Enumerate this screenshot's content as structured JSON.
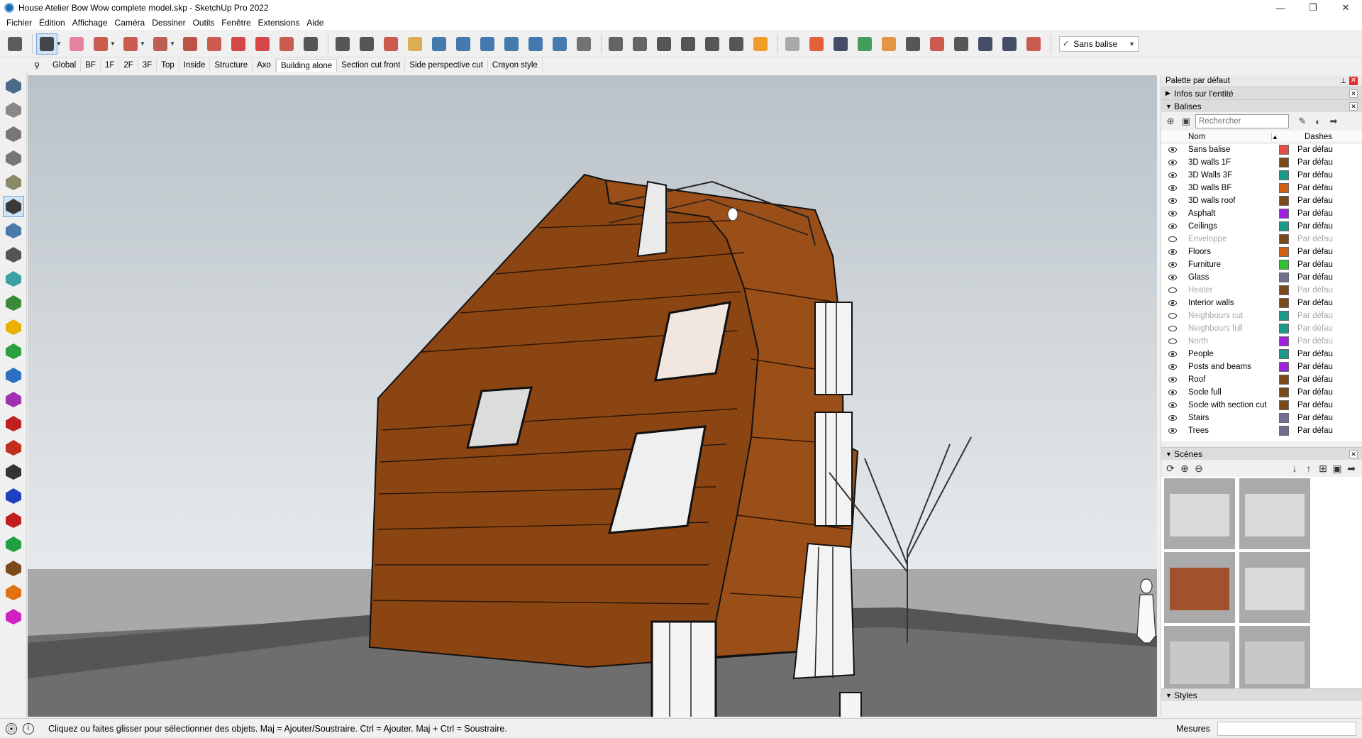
{
  "window": {
    "title": "House Atelier Bow Wow complete model.skp - SketchUp Pro 2022",
    "minimize": "—",
    "restore": "❐",
    "close": "✕"
  },
  "menu": [
    "Fichier",
    "Édition",
    "Affichage",
    "Caméra",
    "Dessiner",
    "Outils",
    "Fenêtre",
    "Extensions",
    "Aide"
  ],
  "toolbar": {
    "active_tag": "Sans balise",
    "tools": [
      {
        "name": "zoom-extents-icon",
        "color": "#3a3a3a"
      },
      {
        "name": "select-icon",
        "color": "#222222"
      },
      {
        "name": "eraser-icon",
        "color": "#e06a8c"
      },
      {
        "name": "pencil-icon",
        "color": "#c0392b"
      },
      {
        "name": "arc-icon",
        "color": "#c0392b"
      },
      {
        "name": "rectangle-icon",
        "color": "#b04030"
      },
      {
        "name": "push-pull-icon",
        "color": "#b03020"
      },
      {
        "name": "follow-me-icon",
        "color": "#c0392b"
      },
      {
        "name": "move-icon",
        "color": "#d02020"
      },
      {
        "name": "rotate-icon",
        "color": "#d02020"
      },
      {
        "name": "scale-icon",
        "color": "#c0392b"
      },
      {
        "name": "tape-measure-icon",
        "color": "#333333"
      },
      {
        "name": "text-icon",
        "color": "#333333"
      },
      {
        "name": "paint-bucket-icon",
        "color": "#333333"
      },
      {
        "name": "orbit-icon",
        "color": "#c0392b"
      },
      {
        "name": "pan-icon",
        "color": "#d4a030"
      },
      {
        "name": "zoom-icon",
        "color": "#1f5fa0"
      },
      {
        "name": "zoom-window-icon",
        "color": "#1f5fa0"
      },
      {
        "name": "warehouse-icon",
        "color": "#1f5fa0"
      },
      {
        "name": "section-plane-icon",
        "color": "#1f5fa0"
      },
      {
        "name": "layers-icon",
        "color": "#1f5fa0"
      },
      {
        "name": "sandbox-icon",
        "color": "#1f5fa0"
      },
      {
        "name": "user-account-icon",
        "color": "#555555"
      },
      {
        "name": "iso-view-icon",
        "color": "#444444"
      },
      {
        "name": "front-view-icon",
        "color": "#444444"
      },
      {
        "name": "top-view-icon",
        "color": "#333333"
      },
      {
        "name": "right-view-icon",
        "color": "#333333"
      },
      {
        "name": "back-view-icon",
        "color": "#333333"
      },
      {
        "name": "left-view-icon",
        "color": "#333333"
      },
      {
        "name": "layout-icon",
        "color": "#f08a00"
      },
      {
        "name": "refresh-icon",
        "color": "#999999"
      },
      {
        "name": "style-builder-icon",
        "color": "#e04010"
      },
      {
        "name": "add-icon",
        "color": "#1d2a4a"
      },
      {
        "name": "tree-icon",
        "color": "#1f8a3a"
      },
      {
        "name": "shadow-icon",
        "color": "#e08020"
      },
      {
        "name": "texture-icon",
        "color": "#333333"
      },
      {
        "name": "cloud-icon",
        "color": "#c0392b"
      },
      {
        "name": "settings-icon",
        "color": "#333333"
      },
      {
        "name": "mail-icon",
        "color": "#1d2a4a"
      },
      {
        "name": "info-icon",
        "color": "#1d2a4a"
      },
      {
        "name": "globe-icon",
        "color": "#c0392b"
      }
    ]
  },
  "scene_tabs": [
    "Global",
    "BF",
    "1F",
    "2F",
    "3F",
    "Top",
    "Inside",
    "Structure",
    "Axo",
    "Building alone",
    "Section cut front",
    "Side perspective cut",
    "Crayon style"
  ],
  "active_scene": "Building alone",
  "tray": {
    "title": "Palette par défaut",
    "panels": {
      "entity_info": "Infos sur l'entité",
      "tags": "Balises",
      "scenes": "Scènes",
      "styles": "Styles"
    },
    "tags_search_placeholder": "Rechercher",
    "column_name": "Nom",
    "column_dashes": "Dashes",
    "tags": [
      {
        "name": "Sans balise",
        "color": "#e84a4a",
        "dash": "Par défaut",
        "visible": true
      },
      {
        "name": "3D walls 1F",
        "color": "#7a4a1a",
        "dash": "Par défaut",
        "visible": true
      },
      {
        "name": "3D Walls 3F",
        "color": "#1a9a8a",
        "dash": "Par défaut",
        "visible": true
      },
      {
        "name": "3D walls BF",
        "color": "#d06010",
        "dash": "Par défaut",
        "visible": true
      },
      {
        "name": "3D walls roof",
        "color": "#7a4a1a",
        "dash": "Par défaut",
        "visible": true
      },
      {
        "name": "Asphalt",
        "color": "#a020e0",
        "dash": "Par défaut",
        "visible": true
      },
      {
        "name": "Ceilings",
        "color": "#1a9a8a",
        "dash": "Par défaut",
        "visible": true
      },
      {
        "name": "Enveloppe",
        "color": "#7a4a1a",
        "dash": "Par défaut",
        "visible": false
      },
      {
        "name": "Floors",
        "color": "#d06010",
        "dash": "Par défaut",
        "visible": true
      },
      {
        "name": "Furniture",
        "color": "#30c030",
        "dash": "Par défaut",
        "visible": true
      },
      {
        "name": "Glass",
        "color": "#707090",
        "dash": "Par défaut",
        "visible": true
      },
      {
        "name": "Heater",
        "color": "#7a4a1a",
        "dash": "Par défaut",
        "visible": false
      },
      {
        "name": "Interior walls",
        "color": "#7a4a1a",
        "dash": "Par défaut",
        "visible": true
      },
      {
        "name": "Neighbours cut",
        "color": "#1a9a8a",
        "dash": "Par défaut",
        "visible": false
      },
      {
        "name": "Neighbours full",
        "color": "#1a9a8a",
        "dash": "Par défaut",
        "visible": false
      },
      {
        "name": "North",
        "color": "#a020e0",
        "dash": "Par défaut",
        "visible": false
      },
      {
        "name": "People",
        "color": "#1a9a8a",
        "dash": "Par défaut",
        "visible": true
      },
      {
        "name": "Posts and beams",
        "color": "#a020e0",
        "dash": "Par défaut",
        "visible": true
      },
      {
        "name": "Roof",
        "color": "#7a4a1a",
        "dash": "Par défaut",
        "visible": true
      },
      {
        "name": "Socle full",
        "color": "#7a4a1a",
        "dash": "Par défaut",
        "visible": true
      },
      {
        "name": "Socle with section cut",
        "color": "#7a4a1a",
        "dash": "Par défaut",
        "visible": true
      },
      {
        "name": "Stairs",
        "color": "#707090",
        "dash": "Par défaut",
        "visible": true
      },
      {
        "name": "Trees",
        "color": "#707090",
        "dash": "Par défaut",
        "visible": true
      }
    ]
  },
  "status": {
    "text": "Cliquez ou faites glisser pour sélectionner des objets. Maj = Ajouter/Soustraire. Ctrl = Ajouter. Maj + Ctrl = Soustraire.",
    "measure_label": "Mesures",
    "measure_value": ""
  }
}
